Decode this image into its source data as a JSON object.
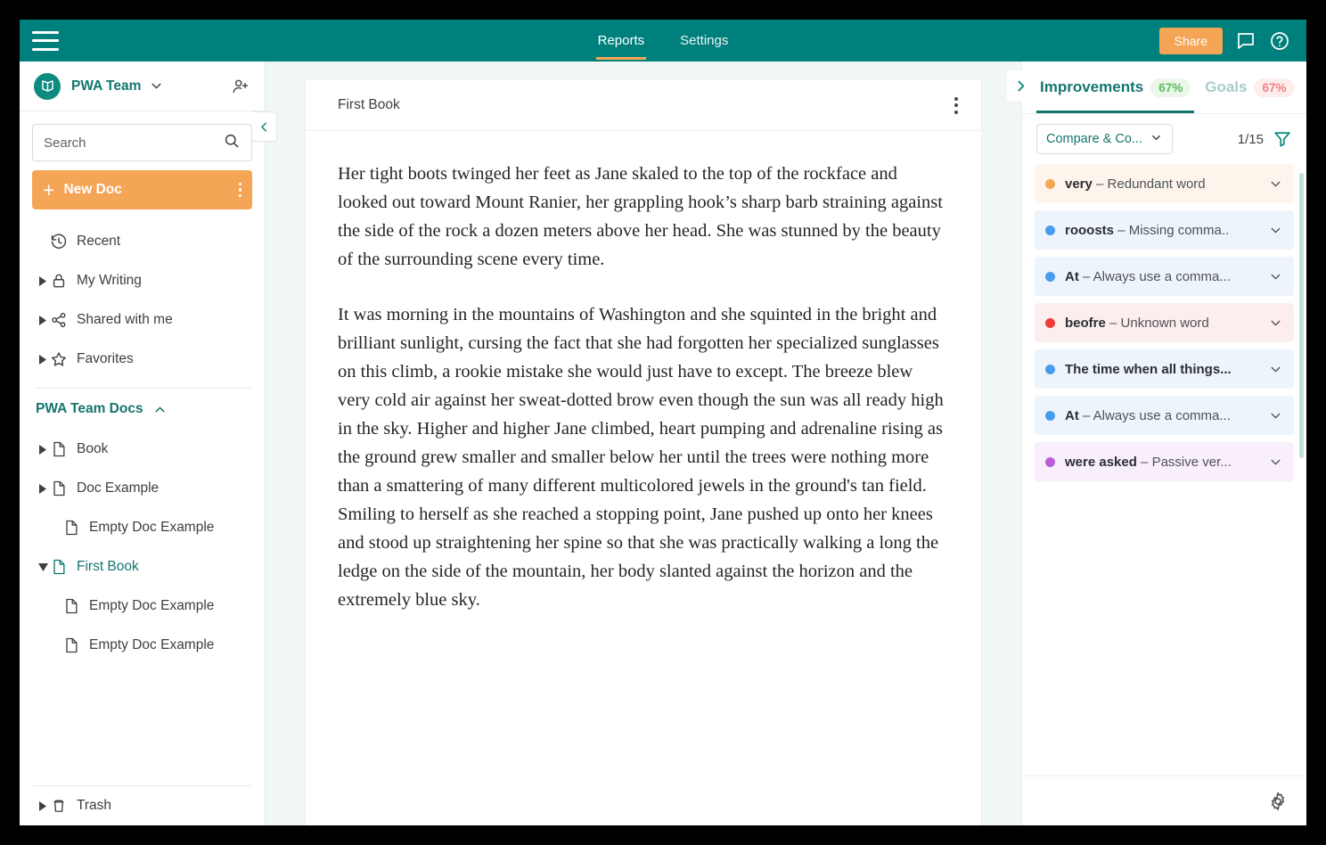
{
  "topbar": {
    "menu_icon": "hamburger-icon",
    "nav": [
      {
        "label": "Reports",
        "active": true
      },
      {
        "label": "Settings",
        "active": false
      }
    ],
    "share_label": "Share",
    "comment_icon": "comment-icon",
    "help_icon": "help-circle-icon"
  },
  "sidebar": {
    "team_name": "PWA Team",
    "team_logo_icon": "book-logo-icon",
    "team_chevron_icon": "chevron-down-icon",
    "add_user_icon": "add-user-icon",
    "search": {
      "value": "",
      "placeholder": "Search",
      "icon": "search-icon"
    },
    "new_doc": {
      "label": "New Doc",
      "plus": "+",
      "kebab_icon": "kebab-menu-icon"
    },
    "nav_items": [
      {
        "label": "Recent",
        "icon": "history-icon",
        "expandable": false
      },
      {
        "label": "My Writing",
        "icon": "lock-icon",
        "expandable": true
      },
      {
        "label": "Shared with me",
        "icon": "share-nodes-icon",
        "expandable": true
      },
      {
        "label": "Favorites",
        "icon": "star-icon",
        "expandable": true
      }
    ],
    "docs_section": {
      "label": "PWA Team Docs",
      "chevron_icon": "chevron-up-icon"
    },
    "tree": [
      {
        "label": "Book",
        "expandable": true,
        "expanded": false,
        "indent": 0,
        "active": false
      },
      {
        "label": "Doc Example",
        "expandable": true,
        "expanded": false,
        "indent": 0,
        "active": false
      },
      {
        "label": "Empty Doc Example",
        "expandable": false,
        "expanded": false,
        "indent": 1,
        "active": false
      },
      {
        "label": "First Book",
        "expandable": true,
        "expanded": true,
        "indent": 0,
        "active": true
      },
      {
        "label": "Empty Doc Example",
        "expandable": false,
        "expanded": false,
        "indent": 1,
        "active": false
      },
      {
        "label": "Empty Doc Example",
        "expandable": false,
        "expanded": false,
        "indent": 1,
        "active": false
      }
    ],
    "trash": {
      "label": "Trash",
      "icon": "trash-icon",
      "expandable": true
    },
    "collapse_icon": "chevron-left-icon"
  },
  "editor": {
    "doc_title": "First Book",
    "kebab_icon": "kebab-menu-icon",
    "paragraphs": [
      "Her tight boots twinged her feet as Jane skaled to the top of the rockface and looked out toward Mount Ranier, her grappling hook’s sharp barb straining against the side of the rock a dozen meters above her head. She was stunned by the beauty of the surrounding scene every time.",
      "It was morning in the mountains of Washington and she squinted in the bright and brilliant sunlight, cursing the fact that she had forgotten her specialized sunglasses on this climb, a rookie mistake she would just have to except. The breeze blew very cold air against her sweat-dotted brow even though the sun was all ready high in the sky. Higher and higher Jane climbed, heart pumping and adrenaline rising as the ground grew smaller and smaller below her until the trees were nothing more than a smattering of many different multicolored jewels in the ground's tan field. Smiling to herself as she reached a stopping point, Jane pushed up onto her knees and stood up straightening her spine so that she was practically walking a long the ledge on the side of the mountain, her body slanted against  the horizon and the extremely blue sky."
    ],
    "panel_open_icon": "chevron-right-icon"
  },
  "right_panel": {
    "tabs": [
      {
        "label": "Improvements",
        "badge": "67%",
        "badge_color": "green",
        "active": true
      },
      {
        "label": "Goals",
        "badge": "67%",
        "badge_color": "red",
        "active": false
      }
    ],
    "filter_select": {
      "label": "Compare & Co...",
      "chevron_icon": "chevron-down-icon"
    },
    "count": "1/15",
    "filter_icon": "funnel-icon",
    "suggestions": [
      {
        "term": "very",
        "desc": " – Redundant word",
        "dot": "#f5a556",
        "bg": "#fdf5ec",
        "chevron_icon": "chevron-down-icon"
      },
      {
        "term": "rooosts",
        "desc": " – Missing comma..",
        "dot": "#4a9bf0",
        "bg": "#eef4fb",
        "chevron_icon": "chevron-down-icon"
      },
      {
        "term": "At",
        "desc": " – Always use a comma...",
        "dot": "#4a9bf0",
        "bg": "#eef4fb",
        "chevron_icon": "chevron-down-icon"
      },
      {
        "term": "beofre",
        "desc": " – Unknown word",
        "dot": "#ee3b3b",
        "bg": "#fdeeee",
        "chevron_icon": "chevron-down-icon"
      },
      {
        "term": "The time when all things...",
        "desc": "",
        "dot": "#4a9bf0",
        "bg": "#eef4fb",
        "chevron_icon": "chevron-down-icon"
      },
      {
        "term": "At",
        "desc": " – Always use a comma...",
        "dot": "#4a9bf0",
        "bg": "#eef4fb",
        "chevron_icon": "chevron-down-icon"
      },
      {
        "term": "were asked",
        "desc": " – Passive ver...",
        "dot": "#b85fd6",
        "bg": "#f9effc",
        "chevron_icon": "chevron-down-icon"
      }
    ],
    "settings_icon": "gear-icon"
  },
  "colors": {
    "teal": "#00807d",
    "teal_dark": "#14756f",
    "orange": "#f5a556",
    "editor_bg": "#f0f7f5"
  }
}
